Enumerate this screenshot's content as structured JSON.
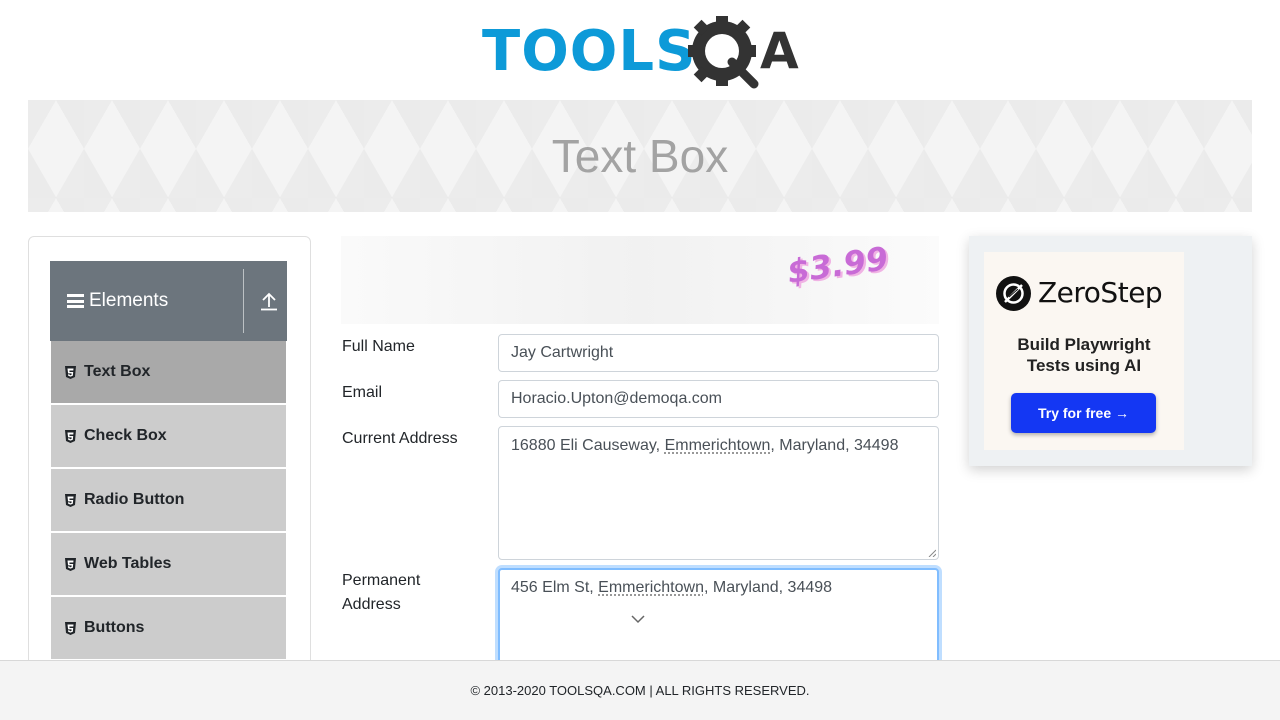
{
  "header": {
    "logo_text_left": "TOOLS",
    "logo_text_right": "A"
  },
  "banner": {
    "title": "Text Box"
  },
  "sidebar": {
    "group_title": "Elements",
    "items": [
      {
        "label": "Text Box",
        "active": true
      },
      {
        "label": "Check Box",
        "active": false
      },
      {
        "label": "Radio Button",
        "active": false
      },
      {
        "label": "Web Tables",
        "active": false
      },
      {
        "label": "Buttons",
        "active": false
      }
    ]
  },
  "ad_strip": {
    "price": "$3.99"
  },
  "form": {
    "full_name": {
      "label": "Full Name",
      "value": "Jay Cartwright"
    },
    "email": {
      "label": "Email",
      "value": "Horacio.Upton@demoqa.com"
    },
    "current_address": {
      "label": "Current Address",
      "value_before": "16880 Eli Causeway, ",
      "value_underlined": "Emmerichtown",
      "value_after": ", Maryland, 34498"
    },
    "permanent_address": {
      "label_line1": "Permanent",
      "label_line2": "Address",
      "value_before": "456 Elm St, ",
      "value_underlined": "Emmerichtown",
      "value_after": ", Maryland, 34498"
    }
  },
  "right_ad": {
    "brand": "ZeroStep",
    "tagline_line1": "Build Playwright",
    "tagline_line2": "Tests using AI",
    "button": "Try for free →"
  },
  "footer": {
    "text": "© 2013-2020 TOOLSQA.COM | ALL RIGHTS RESERVED."
  },
  "colors": {
    "brand_blue": "#0d9ad8",
    "sidebar_header": "#6c757d",
    "active_item": "#a9a9a9",
    "menu_item": "#cccccc",
    "cta_blue": "#1437f3"
  }
}
